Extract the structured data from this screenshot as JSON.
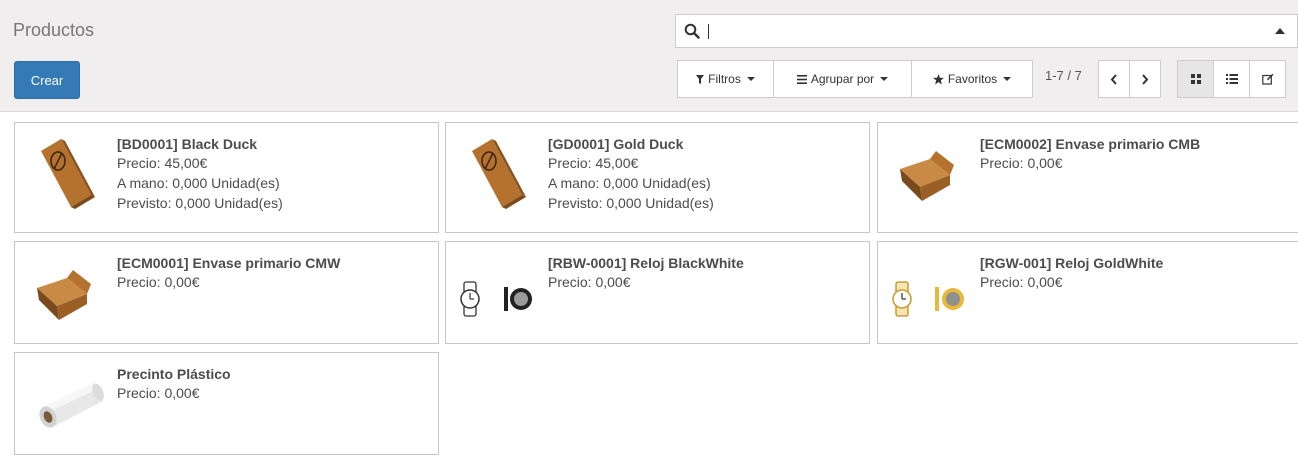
{
  "header": {
    "title": "Productos",
    "create_label": "Crear",
    "search_value": ""
  },
  "toolbar": {
    "filters_label": "Filtros",
    "groupby_label": "Agrupar por",
    "favorites_label": "Favoritos",
    "pager": "1-7 / 7"
  },
  "products": [
    {
      "name": "[BD0001] Black Duck",
      "price": "Precio: 45,00€",
      "onhand": "A mano: 0,000 Unidad(es)",
      "forecast": "Previsto: 0,000 Unidad(es)",
      "image": "wooden-box-icon"
    },
    {
      "name": "[GD0001] Gold Duck",
      "price": "Precio: 45,00€",
      "onhand": "A mano: 0,000 Unidad(es)",
      "forecast": "Previsto: 0,000 Unidad(es)",
      "image": "wooden-box-icon"
    },
    {
      "name": "[ECM0002] Envase primario CMB",
      "price": "Precio: 0,00€",
      "image": "open-box-icon"
    },
    {
      "name": "[ECM0001] Envase primario CMW",
      "price": "Precio: 0,00€",
      "image": "open-box-icon"
    },
    {
      "name": "[RBW-0001] Reloj BlackWhite",
      "price": "Precio: 0,00€",
      "image": "black-watch-icon"
    },
    {
      "name": "[RGW-001] Reloj GoldWhite",
      "price": "Precio: 0,00€",
      "image": "gold-watch-icon"
    },
    {
      "name": "Precinto Plástico",
      "price": "Precio: 0,00€",
      "image": "plastic-roll-icon"
    }
  ],
  "colors": {
    "primary": "#337ab7",
    "panel": "#f0eeee",
    "wood": "#b5722f",
    "gold": "#e8b83a"
  }
}
